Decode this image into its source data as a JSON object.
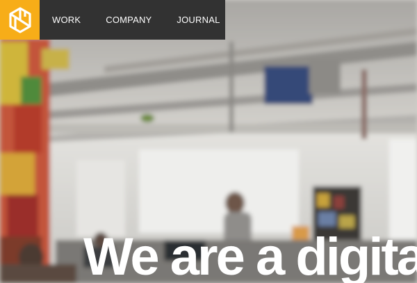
{
  "header": {
    "logo_icon": "brand-hexagon-icon",
    "logo_color": "#f7ad18",
    "nav_background": "#323232",
    "nav": [
      {
        "label": "WORK"
      },
      {
        "label": "COMPANY"
      },
      {
        "label": "JOURNAL"
      }
    ]
  },
  "hero": {
    "headline": "We are a digital"
  }
}
